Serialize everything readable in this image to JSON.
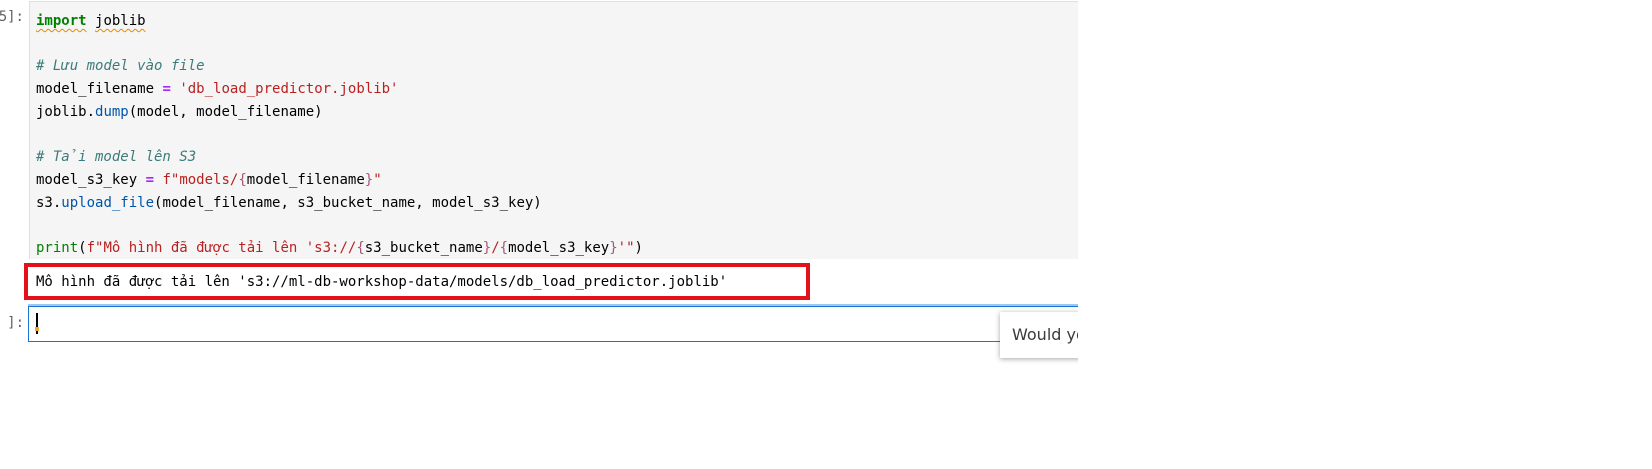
{
  "cells": {
    "executed": {
      "prompt": "5]:",
      "code": {
        "l1_kw": "import",
        "l1_mod": "joblib",
        "l3_comment": "# Lưu model vào file",
        "l4_var": "model_filename",
        "l4_op": "=",
        "l4_str": "'db_load_predictor.joblib'",
        "l5_obj": "joblib",
        "l5_dot": ".",
        "l5_fn": "dump",
        "l5_args": "(model, model_filename)",
        "l7_comment": "# Tải model lên S3",
        "l8_var": "model_s3_key",
        "l8_op": "=",
        "l8_fpre": "f\"models/",
        "l8_lbrace": "{",
        "l8_interp": "model_filename",
        "l8_rbrace": "}",
        "l8_fend": "\"",
        "l9_obj": "s3",
        "l9_dot": ".",
        "l9_fn": "upload_file",
        "l9_args": "(model_filename, s3_bucket_name, model_s3_key)",
        "l11_fn": "print",
        "l11_open": "(",
        "l11_fpre": "f\"Mô hình đã được tải lên 's3://",
        "l11_lbrace1": "{",
        "l11_interp1": "s3_bucket_name",
        "l11_rbrace1": "}",
        "l11_slash": "/",
        "l11_lbrace2": "{",
        "l11_interp2": "model_s3_key",
        "l11_rbrace2": "}",
        "l11_fend": "'\"",
        "l11_close": ")"
      },
      "output": "Mô hình đã được tải lên 's3://ml-db-workshop-data/models/db_load_predictor.joblib'"
    },
    "next": {
      "prompt": "]:",
      "value": ""
    }
  },
  "toast": {
    "text": "Would yo"
  },
  "colors": {
    "highlight_border": "#e3111b",
    "active_cell_border": "#1a75d1",
    "code_background": "#f5f5f5"
  }
}
